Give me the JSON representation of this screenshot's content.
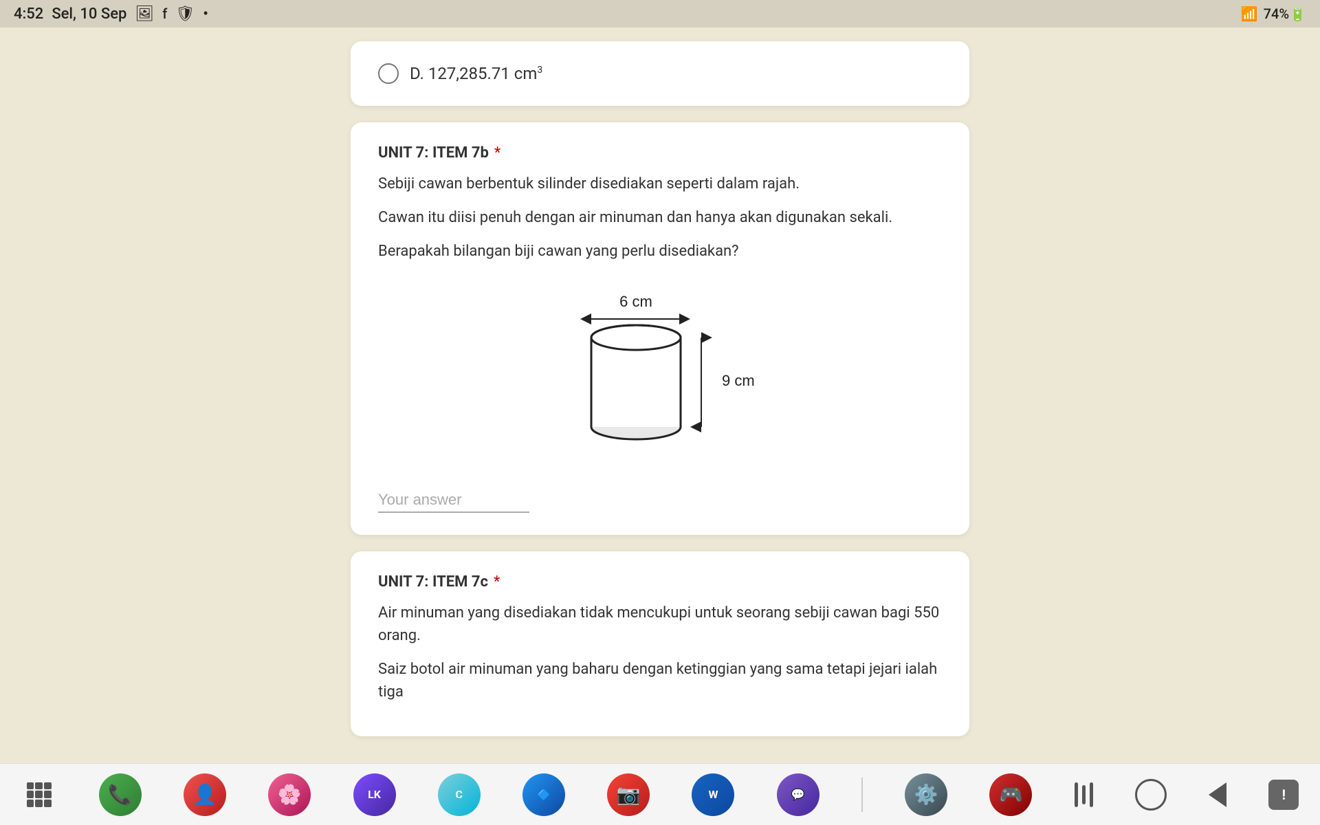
{
  "statusBar": {
    "time": "4:52",
    "date": "Sel, 10 Sep",
    "battery": "74%",
    "wifi": "wifi",
    "signal": "signal"
  },
  "optionCard": {
    "optionLabel": "D. 127,285.71",
    "optionUnit": "cm",
    "optionSuperscript": "3"
  },
  "questionCard7b": {
    "title": "UNIT 7: ITEM 7b",
    "required": "*",
    "line1": "Sebiji cawan berbentuk silinder disediakan seperti dalam rajah.",
    "line2": "Cawan itu diisi penuh dengan air minuman dan hanya akan digunakan sekali.",
    "line3": "Berapakah bilangan biji cawan yang perlu disediakan?",
    "diagram": {
      "widthLabel": "6 cm",
      "heightLabel": "9 cm"
    },
    "answerPlaceholder": "Your answer"
  },
  "questionCard7c": {
    "title": "UNIT 7: ITEM 7c",
    "required": "*",
    "line1": "Air minuman yang disediakan tidak mencukupi untuk seorang sebiji cawan bagi 550 orang.",
    "line2": "Saiz botol air minuman yang baharu dengan ketinggian yang sama tetapi jejari ialah tiga"
  },
  "bottomNav": {
    "apps": "apps",
    "phone": "phone",
    "contacts": "contacts",
    "flower": "flower",
    "loklok": "loklok",
    "canva": "canva",
    "microsoft": "microsoft",
    "camera": "camera",
    "word": "word",
    "teams": "teams",
    "settings": "settings",
    "game": "game",
    "menu": "menu",
    "home": "home",
    "back": "back"
  }
}
